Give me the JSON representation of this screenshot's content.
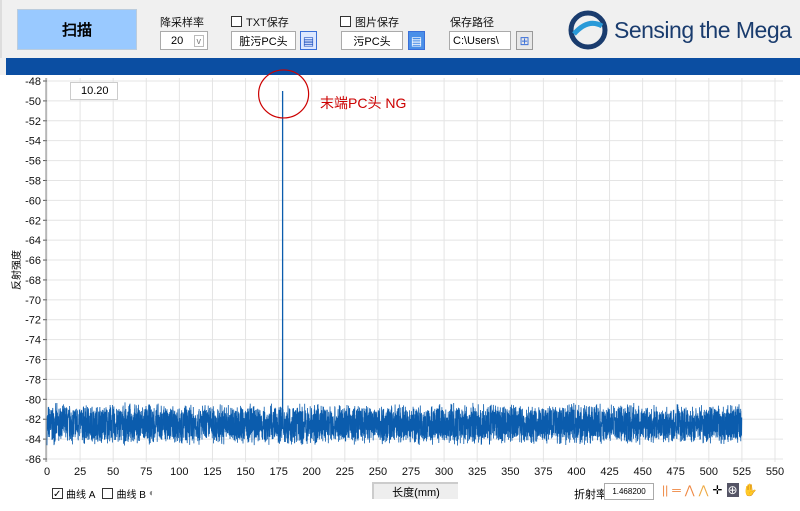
{
  "toolbar": {
    "scan_label": "扫描",
    "downsample_label": "降采样率",
    "downsample_value": "20",
    "txt_save_label": "TXT保存",
    "txt_save_checked": false,
    "txt_name": "脏污PC头",
    "img_save_label": "图片保存",
    "img_save_checked": false,
    "img_name": "污PC头",
    "path_label": "保存路径",
    "path_value": "C:\\Users\\"
  },
  "logo": {
    "text": "Sensing the Mega"
  },
  "chart": {
    "cursor_value": "10.20",
    "annotation": "末端PC头 NG",
    "xlabel": "长度(mm)",
    "ylabel": "反射强度"
  },
  "footer": {
    "curve_a": "曲线 A",
    "curve_a_checked": true,
    "curve_b": "曲线 B",
    "curve_b_checked": false,
    "ri_label": "折射率",
    "ri_value": "1.468200"
  },
  "chart_data": {
    "type": "line",
    "xlabel": "长度(mm)",
    "ylabel": "反射强度",
    "xlim": [
      0,
      550
    ],
    "ylim": [
      -86,
      -48
    ],
    "xticks": [
      0,
      25,
      50,
      75,
      100,
      125,
      150,
      175,
      200,
      225,
      250,
      275,
      300,
      325,
      350,
      375,
      400,
      425,
      450,
      475,
      500,
      525,
      550
    ],
    "yticks": [
      -48,
      -50,
      -52,
      -54,
      -56,
      -58,
      -60,
      -62,
      -64,
      -66,
      -68,
      -70,
      -72,
      -74,
      -76,
      -78,
      -80,
      -82,
      -84,
      -86
    ],
    "grid": true,
    "color": "#0b5cad",
    "series": [
      {
        "x_range": [
          0,
          525
        ],
        "noise_floor": [
          -84.5,
          -80.5
        ],
        "peaks": [
          {
            "x": 178,
            "y": -49
          }
        ]
      }
    ]
  }
}
